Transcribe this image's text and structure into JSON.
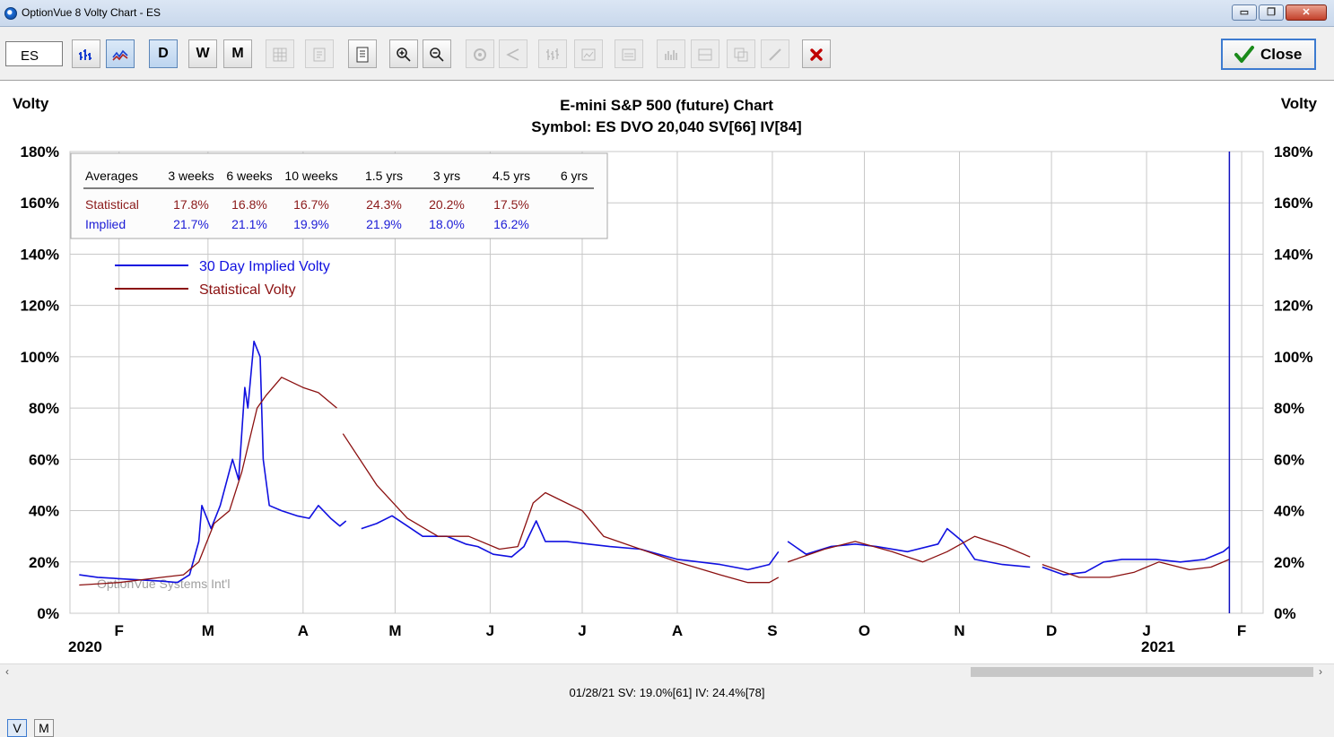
{
  "window": {
    "title": "OptionVue 8 Volty Chart - ES",
    "minimize_label": "▭",
    "restore_label": "❐",
    "close_label": "✕"
  },
  "toolbar": {
    "symbol_value": "ES",
    "day_label": "D",
    "week_label": "W",
    "month_label": "M",
    "close_label": "Close"
  },
  "chart": {
    "title": "E-mini S&P 500 (future) Chart",
    "subtitle": "Symbol: ES  DVO 20,040  SV[66]  IV[84]",
    "left_axis_title": "Volty",
    "right_axis_title": "Volty",
    "watermark": "OptionVue Systems Int'l",
    "averages_table": {
      "headers": [
        "Averages",
        "3 weeks",
        "6 weeks",
        "10 weeks",
        "1.5 yrs",
        "3 yrs",
        "4.5 yrs",
        "6 yrs"
      ],
      "rows": [
        {
          "label": "Statistical",
          "values": [
            "17.8%",
            "16.8%",
            "16.7%",
            "24.3%",
            "20.2%",
            "17.5%",
            ""
          ],
          "color": "#8b1a1a"
        },
        {
          "label": "Implied",
          "values": [
            "21.7%",
            "21.1%",
            "19.9%",
            "21.9%",
            "18.0%",
            "16.2%",
            ""
          ],
          "color": "#1c1cd6"
        }
      ]
    },
    "legend": [
      {
        "label": "30 Day Implied Volty",
        "color": "#1010e0"
      },
      {
        "label": "Statistical Volty",
        "color": "#8b1010"
      }
    ],
    "year_labels": [
      "2020",
      "2021"
    ]
  },
  "chart_data": {
    "type": "line",
    "title": "E-mini S&P 500 (future) Chart",
    "subtitle": "Symbol: ES  DVO 20,040  SV[66]  IV[84]",
    "ylabel": "Volty",
    "ylim": [
      0,
      180
    ],
    "y_ticks": [
      "0%",
      "20%",
      "40%",
      "60%",
      "80%",
      "100%",
      "120%",
      "140%",
      "160%",
      "180%"
    ],
    "x_ticks": [
      "F",
      "M",
      "A",
      "M",
      "J",
      "J",
      "A",
      "S",
      "O",
      "N",
      "D",
      "J",
      "F"
    ],
    "x_tick_dates": [
      "2020-02-01",
      "2020-03-01",
      "2020-04-01",
      "2020-05-01",
      "2020-06-01",
      "2020-07-01",
      "2020-08-01",
      "2020-09-01",
      "2020-10-01",
      "2020-11-01",
      "2020-12-01",
      "2021-01-01",
      "2021-02-01"
    ],
    "xlim": [
      "2020-01-16",
      "2021-02-08"
    ],
    "grid": true,
    "cursor_date": "2021-01-28",
    "series": [
      {
        "name": "30 Day Implied Volty",
        "color": "#1010e0",
        "points": [
          [
            "2020-01-19",
            15
          ],
          [
            "2020-01-25",
            14
          ],
          [
            "2020-02-01",
            13.5
          ],
          [
            "2020-02-08",
            13
          ],
          [
            "2020-02-15",
            12.5
          ],
          [
            "2020-02-20",
            12
          ],
          [
            "2020-02-24",
            15
          ],
          [
            "2020-02-27",
            28
          ],
          [
            "2020-02-28",
            42
          ],
          [
            "2020-03-02",
            33
          ],
          [
            "2020-03-05",
            42
          ],
          [
            "2020-03-09",
            60
          ],
          [
            "2020-03-11",
            52
          ],
          [
            "2020-03-13",
            88
          ],
          [
            "2020-03-14",
            80
          ],
          [
            "2020-03-16",
            106
          ],
          [
            "2020-03-18",
            100
          ],
          [
            "2020-03-19",
            60
          ],
          [
            "2020-03-21",
            42
          ],
          [
            "2020-03-25",
            40
          ],
          [
            "2020-03-30",
            38
          ],
          [
            "2020-04-03",
            37
          ],
          [
            "2020-04-06",
            42
          ],
          [
            "2020-04-10",
            37
          ],
          [
            "2020-04-13",
            34
          ],
          [
            "2020-04-15",
            36
          ]
        ],
        "points_segment2": [
          [
            "2020-04-20",
            33
          ],
          [
            "2020-04-25",
            35
          ],
          [
            "2020-04-30",
            38
          ],
          [
            "2020-05-05",
            34
          ],
          [
            "2020-05-10",
            30
          ],
          [
            "2020-05-18",
            30
          ],
          [
            "2020-05-24",
            27
          ],
          [
            "2020-05-28",
            26
          ],
          [
            "2020-06-02",
            23
          ],
          [
            "2020-06-08",
            22
          ],
          [
            "2020-06-12",
            26
          ],
          [
            "2020-06-16",
            36
          ],
          [
            "2020-06-19",
            28
          ],
          [
            "2020-06-26",
            28
          ],
          [
            "2020-07-03",
            27
          ],
          [
            "2020-07-10",
            26
          ],
          [
            "2020-07-20",
            25
          ],
          [
            "2020-08-01",
            21
          ],
          [
            "2020-08-15",
            19
          ],
          [
            "2020-08-24",
            17
          ],
          [
            "2020-08-31",
            19
          ],
          [
            "2020-09-03",
            24
          ]
        ],
        "points_segment3": [
          [
            "2020-09-06",
            28
          ],
          [
            "2020-09-12",
            23
          ],
          [
            "2020-09-20",
            26
          ],
          [
            "2020-09-28",
            27
          ],
          [
            "2020-10-05",
            26
          ],
          [
            "2020-10-15",
            24
          ],
          [
            "2020-10-25",
            27
          ],
          [
            "2020-10-28",
            33
          ],
          [
            "2020-11-02",
            28
          ],
          [
            "2020-11-06",
            21
          ],
          [
            "2020-11-15",
            19
          ],
          [
            "2020-11-24",
            18
          ]
        ],
        "points_segment4": [
          [
            "2020-11-28",
            18
          ],
          [
            "2020-12-05",
            15
          ],
          [
            "2020-12-12",
            16
          ],
          [
            "2020-12-18",
            20
          ],
          [
            "2020-12-24",
            21
          ],
          [
            "2021-01-04",
            21
          ],
          [
            "2021-01-12",
            20
          ],
          [
            "2021-01-20",
            21
          ],
          [
            "2021-01-26",
            24
          ],
          [
            "2021-01-28",
            26
          ]
        ]
      },
      {
        "name": "Statistical Volty",
        "color": "#8b1010",
        "points": [
          [
            "2020-01-19",
            11
          ],
          [
            "2020-02-01",
            12
          ],
          [
            "2020-02-15",
            14
          ],
          [
            "2020-02-22",
            15
          ],
          [
            "2020-02-27",
            20
          ],
          [
            "2020-03-03",
            35
          ],
          [
            "2020-03-08",
            40
          ],
          [
            "2020-03-12",
            55
          ],
          [
            "2020-03-17",
            80
          ],
          [
            "2020-03-20",
            85
          ],
          [
            "2020-03-25",
            92
          ],
          [
            "2020-04-01",
            88
          ],
          [
            "2020-04-06",
            86
          ],
          [
            "2020-04-12",
            80
          ]
        ],
        "points_segment2": [
          [
            "2020-04-14",
            70
          ],
          [
            "2020-04-25",
            50
          ],
          [
            "2020-05-05",
            37
          ],
          [
            "2020-05-15",
            30
          ],
          [
            "2020-05-25",
            30
          ],
          [
            "2020-06-04",
            25
          ],
          [
            "2020-06-10",
            26
          ],
          [
            "2020-06-15",
            43
          ],
          [
            "2020-06-19",
            47
          ],
          [
            "2020-07-01",
            40
          ],
          [
            "2020-07-08",
            30
          ],
          [
            "2020-07-20",
            25
          ],
          [
            "2020-08-01",
            20
          ],
          [
            "2020-08-15",
            15
          ],
          [
            "2020-08-24",
            12
          ],
          [
            "2020-08-31",
            12
          ],
          [
            "2020-09-03",
            14
          ]
        ],
        "points_segment3": [
          [
            "2020-09-06",
            20
          ],
          [
            "2020-09-18",
            25
          ],
          [
            "2020-09-28",
            28
          ],
          [
            "2020-10-10",
            24
          ],
          [
            "2020-10-20",
            20
          ],
          [
            "2020-10-28",
            24
          ],
          [
            "2020-11-06",
            30
          ],
          [
            "2020-11-16",
            26
          ],
          [
            "2020-11-24",
            22
          ]
        ],
        "points_segment4": [
          [
            "2020-11-28",
            19
          ],
          [
            "2020-12-10",
            14
          ],
          [
            "2020-12-20",
            14
          ],
          [
            "2020-12-28",
            16
          ],
          [
            "2021-01-05",
            20
          ],
          [
            "2021-01-15",
            17
          ],
          [
            "2021-01-22",
            18
          ],
          [
            "2021-01-28",
            21
          ]
        ]
      }
    ]
  },
  "bottom": {
    "mode_v_label": "V",
    "mode_m_label": "M",
    "status_text": "01/28/21   SV: 19.0%[61]   IV: 24.4%[78]"
  }
}
